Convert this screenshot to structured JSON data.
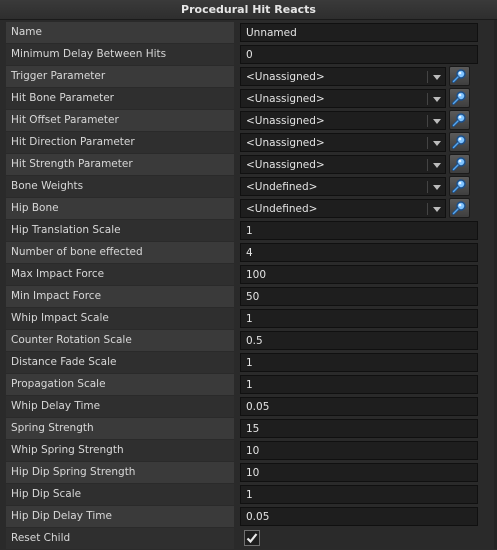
{
  "panel": {
    "title": "Procedural Hit Reacts"
  },
  "rows": [
    {
      "label": "Name",
      "kind": "text",
      "value": "Unnamed"
    },
    {
      "label": "Minimum Delay Between Hits",
      "kind": "text",
      "value": "0"
    },
    {
      "label": "Trigger Parameter",
      "kind": "combo",
      "value": "<Unassigned>"
    },
    {
      "label": "Hit Bone Parameter",
      "kind": "combo",
      "value": "<Unassigned>"
    },
    {
      "label": "Hit Offset Parameter",
      "kind": "combo",
      "value": "<Unassigned>"
    },
    {
      "label": "Hit Direction Parameter",
      "kind": "combo",
      "value": "<Unassigned>"
    },
    {
      "label": "Hit Strength Parameter",
      "kind": "combo",
      "value": "<Unassigned>"
    },
    {
      "label": "Bone Weights",
      "kind": "combo",
      "value": "<Undefined>"
    },
    {
      "label": "Hip Bone",
      "kind": "combo",
      "value": "<Undefined>"
    },
    {
      "label": "Hip Translation Scale",
      "kind": "text",
      "value": "1"
    },
    {
      "label": "Number of bone effected",
      "kind": "text",
      "value": "4"
    },
    {
      "label": "Max Impact Force",
      "kind": "text",
      "value": "100"
    },
    {
      "label": "Min Impact Force",
      "kind": "text",
      "value": "50"
    },
    {
      "label": "Whip Impact Scale",
      "kind": "text",
      "value": "1"
    },
    {
      "label": "Counter Rotation Scale",
      "kind": "text",
      "value": "0.5"
    },
    {
      "label": "Distance Fade Scale",
      "kind": "text",
      "value": "1"
    },
    {
      "label": "Propagation Scale",
      "kind": "text",
      "value": "1"
    },
    {
      "label": "Whip Delay Time",
      "kind": "text",
      "value": "0.05"
    },
    {
      "label": "Spring Strength",
      "kind": "text",
      "value": "15"
    },
    {
      "label": "Whip Spring Strength",
      "kind": "text",
      "value": "10"
    },
    {
      "label": "Hip Dip Spring Strength",
      "kind": "text",
      "value": "10"
    },
    {
      "label": "Hip Dip Scale",
      "kind": "text",
      "value": "1"
    },
    {
      "label": "Hip Dip Delay Time",
      "kind": "text",
      "value": "0.05"
    },
    {
      "label": "Reset Child",
      "kind": "checkbox",
      "checked": true
    }
  ],
  "icons": {
    "picker": "magnifier-picker-icon",
    "dropdown": "chevron-down-icon",
    "check": "checkmark-icon"
  },
  "colors": {
    "background": "#2a2a2a",
    "field": "#1e1e1e",
    "label_odd": "#3a3a3a",
    "label_even": "#2f2f2f"
  }
}
